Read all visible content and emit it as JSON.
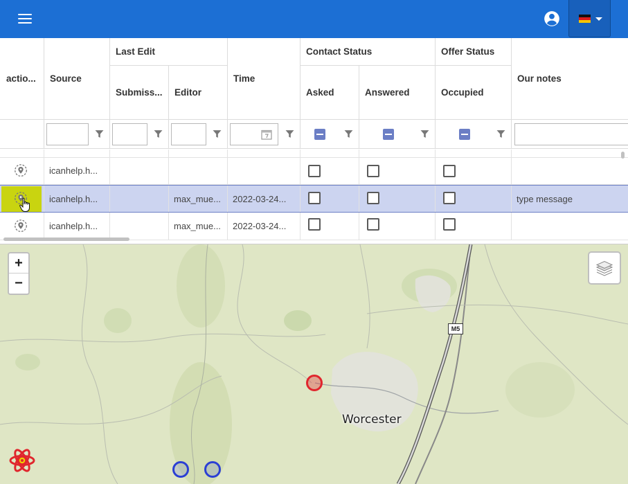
{
  "header": {
    "menu_icon": "hamburger-menu-icon",
    "account_icon": "account-circle-icon",
    "language_icon": "german-flag-icon",
    "brand_color": "#1c6fd4"
  },
  "grid": {
    "group_headers": {
      "last_edit": "Last Edit",
      "contact_status": "Contact Status",
      "offer_status": "Offer Status"
    },
    "columns": {
      "actions": "actio...",
      "source": "Source",
      "submission": "Submiss...",
      "editor": "Editor",
      "time": "Time",
      "asked": "Asked",
      "answered": "Answered",
      "occupied": "Occupied",
      "notes": "Our notes"
    },
    "rows": [
      {
        "source": "icanhelp.h...",
        "submission": "",
        "editor": "",
        "time": "",
        "asked": false,
        "answered": false,
        "occupied": false,
        "notes": ""
      },
      {
        "source": "icanhelp.h...",
        "submission": "",
        "editor": "max_mue...",
        "time": "2022-03-24...",
        "asked": false,
        "answered": false,
        "occupied": false,
        "notes": "type message",
        "selected": true
      },
      {
        "source": "icanhelp.h...",
        "submission": "",
        "editor": "max_mue...",
        "time": "2022-03-24...",
        "asked": false,
        "answered": false,
        "occupied": false,
        "notes": ""
      }
    ],
    "selection_color": "#ccd4f0"
  },
  "map": {
    "zoom_in": "+",
    "zoom_out": "−",
    "city_label": "Worcester",
    "road_label": "M5",
    "markers": [
      {
        "type": "selected",
        "color": "#e0262d"
      },
      {
        "type": "normal",
        "color": "#2b3fd4"
      },
      {
        "type": "normal",
        "color": "#2b3fd4"
      }
    ]
  }
}
